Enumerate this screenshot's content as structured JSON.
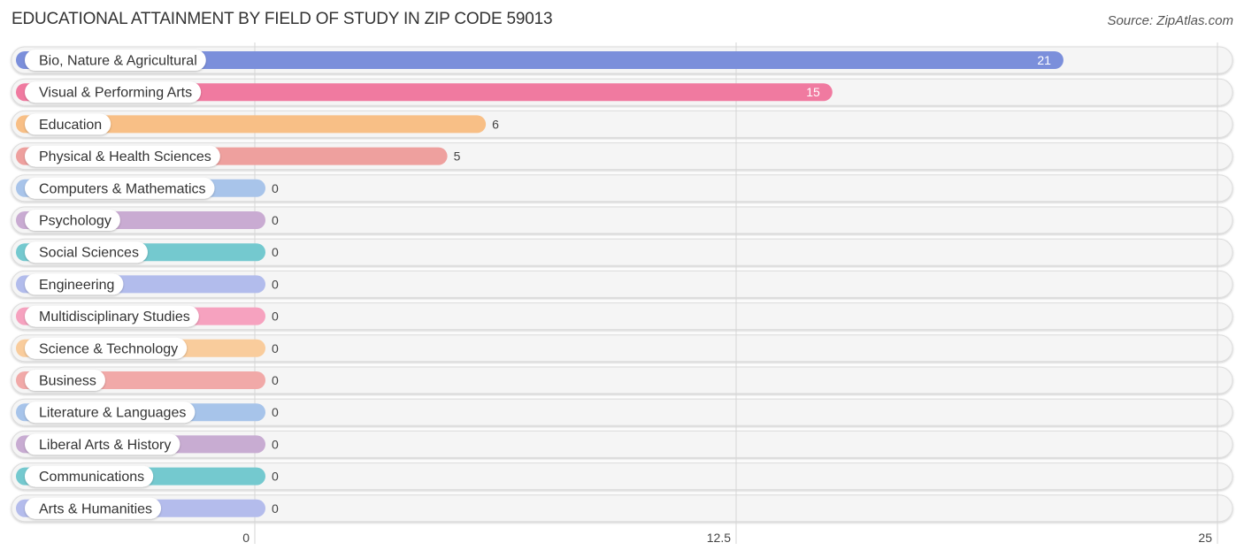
{
  "chart_data": {
    "type": "bar",
    "orientation": "horizontal",
    "title": "EDUCATIONAL ATTAINMENT BY FIELD OF STUDY IN ZIP CODE 59013",
    "source": "Source: ZipAtlas.com",
    "xlabel": "",
    "ylabel": "",
    "xlim": [
      0,
      25
    ],
    "xticks": [
      "0",
      "12.5",
      "25"
    ],
    "xtick_values": [
      0,
      12.5,
      25
    ],
    "grid": true,
    "categories": [
      "Bio, Nature & Agricultural",
      "Visual & Performing Arts",
      "Education",
      "Physical & Health Sciences",
      "Computers & Mathematics",
      "Psychology",
      "Social Sciences",
      "Engineering",
      "Multidisciplinary Studies",
      "Science & Technology",
      "Business",
      "Literature & Languages",
      "Liberal Arts & History",
      "Communications",
      "Arts & Humanities"
    ],
    "values": [
      21,
      15,
      6,
      5,
      0,
      0,
      0,
      0,
      0,
      0,
      0,
      0,
      0,
      0,
      0
    ],
    "value_labels": [
      "21",
      "15",
      "6",
      "5",
      "0",
      "0",
      "0",
      "0",
      "0",
      "0",
      "0",
      "0",
      "0",
      "0",
      "0"
    ],
    "colors": [
      "#7b8fdb",
      "#f07aa0",
      "#f8bf86",
      "#eea09e",
      "#a8c4ea",
      "#c9abd2",
      "#74c9cf",
      "#b2bcec",
      "#f6a2bf",
      "#f9cc9c",
      "#f1a9a8",
      "#a7c4ea",
      "#c8acd2",
      "#74c9cf",
      "#b4bcec"
    ]
  }
}
